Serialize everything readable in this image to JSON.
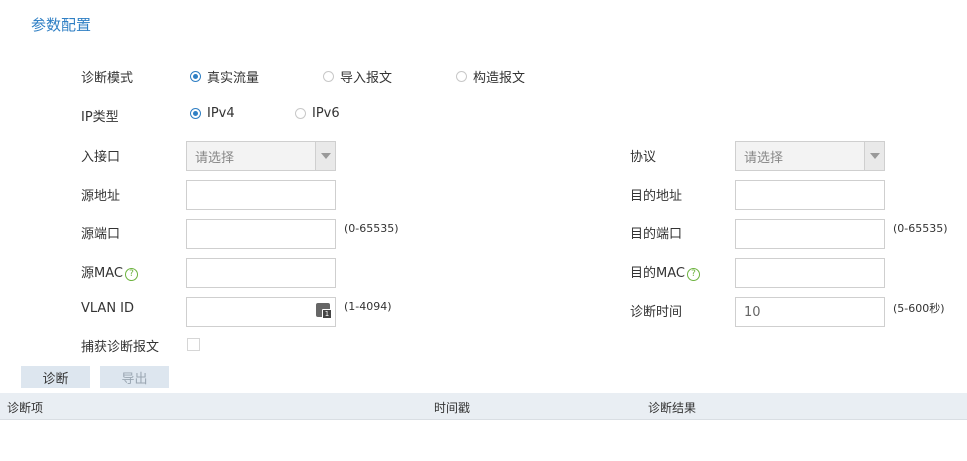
{
  "page": {
    "title": "参数配置"
  },
  "mode": {
    "label": "诊断模式",
    "options": [
      {
        "label": "真实流量",
        "selected": true
      },
      {
        "label": "导入报文",
        "selected": false
      },
      {
        "label": "构造报文",
        "selected": false
      }
    ]
  },
  "ip_type": {
    "label": "IP类型",
    "options": [
      {
        "label": "IPv4",
        "selected": true
      },
      {
        "label": "IPv6",
        "selected": false
      }
    ]
  },
  "fields": {
    "ingress": {
      "label": "入接口",
      "value": "请选择"
    },
    "protocol": {
      "label": "协议",
      "value": "请选择"
    },
    "src_addr": {
      "label": "源地址",
      "value": ""
    },
    "dst_addr": {
      "label": "目的地址",
      "value": ""
    },
    "src_port": {
      "label": "源端口",
      "value": "",
      "hint": "(0-65535)"
    },
    "dst_port": {
      "label": "目的端口",
      "value": "",
      "hint": "(0-65535)"
    },
    "src_mac": {
      "label": "源MAC",
      "value": "",
      "help": "?"
    },
    "dst_mac": {
      "label": "目的MAC",
      "value": "",
      "help": "?"
    },
    "vlan": {
      "label": "VLAN ID",
      "value": "",
      "hint": "(1-4094)"
    },
    "diag_time": {
      "label": "诊断时间",
      "value": "10",
      "hint": "(5-600秒)"
    },
    "capture": {
      "label": "捕获诊断报文",
      "checked": false
    }
  },
  "buttons": {
    "diagnose": "诊断",
    "export": "导出"
  },
  "table": {
    "columns": [
      "诊断项",
      "时间戳",
      "诊断结果"
    ]
  },
  "colors": {
    "accent": "#2f7fc4",
    "help": "#6db33f",
    "header_bg": "#e9eef3",
    "button_bg": "#dde6ef"
  }
}
